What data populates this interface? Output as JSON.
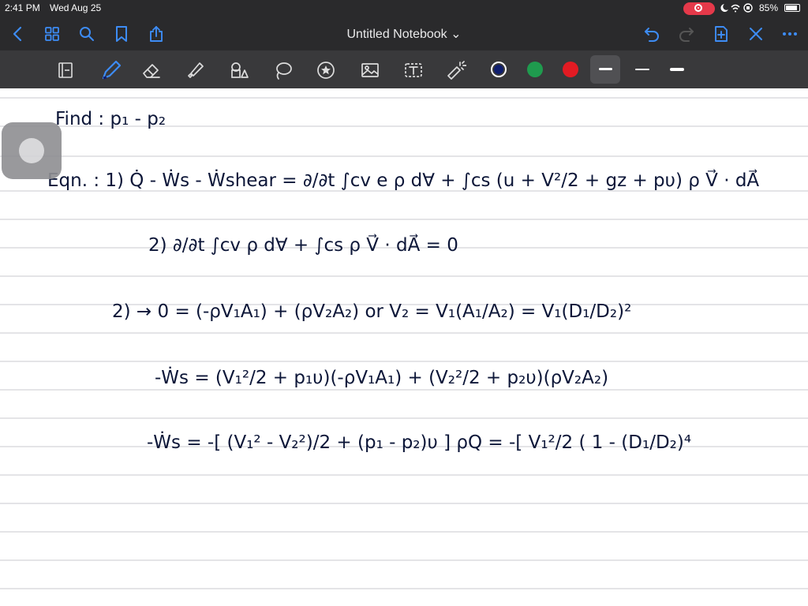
{
  "status_bar": {
    "time": "2:41 PM",
    "date": "Wed Aug 25",
    "battery": "85%"
  },
  "nav": {
    "title": "Untitled Notebook ⌄"
  },
  "toolbar": {
    "tools": [
      "page-icon",
      "pen-icon",
      "eraser-icon",
      "highlighter-icon",
      "shapes-icon",
      "lasso-icon",
      "sticker-icon",
      "image-icon",
      "text-icon",
      "laser-pointer-icon"
    ],
    "colors": [
      "#0f1e6e",
      "#1f9b4e",
      "#e21b23"
    ],
    "accent": "#3d8cf5"
  },
  "notes": {
    "line1": "Find :      p₁ - p₂",
    "line2": "Eqn. :     1)  Q̇ - Ẇs - Ẇshear = ∂/∂t ∫cv e ρ d∀  +  ∫cs (u + V²/2 + gz + pυ) ρ V⃗ · dA⃗",
    "line3": "2)   ∂/∂t ∫cv ρ d∀  +  ∫cs ρ V⃗ · dA⃗ = 0",
    "line4": "2) →   0 = (-ρV₁A₁) + (ρV₂A₂)    or   V₂ = V₁(A₁/A₂) = V₁(D₁/D₂)²",
    "line5": "-Ẇs = (V₁²/2 + p₁υ)(-ρV₁A₁)  +  (V₂²/2 + p₂υ)(ρV₂A₂)",
    "line6": "-Ẇs = -[ (V₁² - V₂²)/2 + (p₁ - p₂)υ ] ρQ = -[ V₁²/2 ( 1 - (D₁/D₂)⁴"
  }
}
